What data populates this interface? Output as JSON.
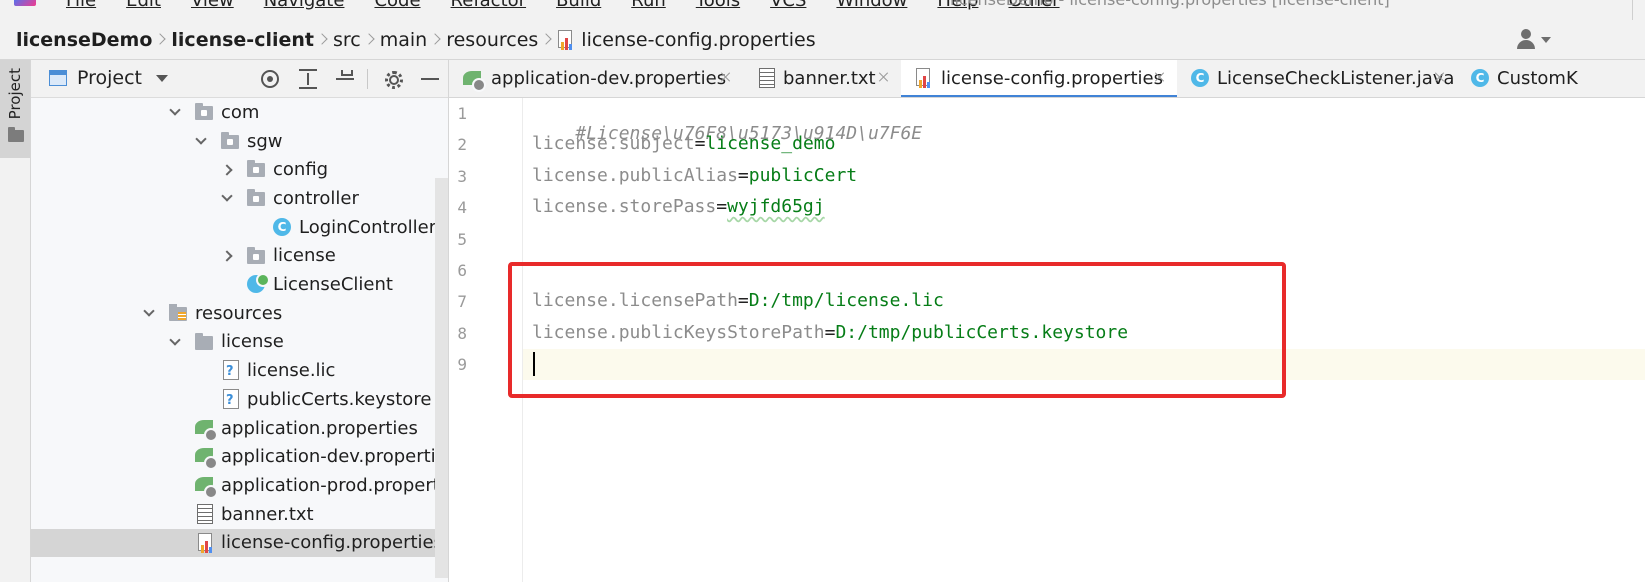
{
  "menu": {
    "items": [
      "File",
      "Edit",
      "View",
      "Navigate",
      "Code",
      "Refactor",
      "Build",
      "Run",
      "Tools",
      "VCS",
      "Window",
      "Help",
      "Other"
    ],
    "window_title": "licenseDemo - license-config.properties [license-client]"
  },
  "breadcrumb": {
    "items": [
      "licenseDemo",
      "license-client",
      "src",
      "main",
      "resources"
    ],
    "current_file": "license-config.properties"
  },
  "toolstrip": {
    "project_label": "Project"
  },
  "project_panel": {
    "title": "Project",
    "tree": [
      {
        "label": "com",
        "expanded": true,
        "icon": "folder-icon"
      },
      {
        "label": "sgw",
        "expanded": true,
        "icon": "folder-icon"
      },
      {
        "label": "config",
        "expanded": false,
        "icon": "folder-icon"
      },
      {
        "label": "controller",
        "expanded": true,
        "icon": "folder-icon"
      },
      {
        "label": "LoginController",
        "icon": "class-icon"
      },
      {
        "label": "license",
        "expanded": false,
        "icon": "folder-icon"
      },
      {
        "label": "LicenseClient",
        "icon": "spring-boot-class-icon"
      },
      {
        "label": "resources",
        "expanded": true,
        "icon": "resources-folder-icon"
      },
      {
        "label": "license",
        "expanded": true,
        "icon": "folder-icon"
      },
      {
        "label": "license.lic",
        "icon": "unknown-file-icon"
      },
      {
        "label": "publicCerts.keystore",
        "icon": "unknown-file-icon"
      },
      {
        "label": "application.properties",
        "icon": "spring-properties-icon"
      },
      {
        "label": "application-dev.properties",
        "icon": "spring-properties-icon"
      },
      {
        "label": "application-prod.properties",
        "icon": "spring-properties-icon"
      },
      {
        "label": "banner.txt",
        "icon": "text-file-icon"
      },
      {
        "label": "license-config.properties",
        "icon": "properties-file-icon",
        "selected": true
      }
    ]
  },
  "tabs": [
    {
      "label": "application-dev.properties",
      "icon": "spring-properties-icon"
    },
    {
      "label": "banner.txt",
      "icon": "text-file-icon"
    },
    {
      "label": "license-config.properties",
      "icon": "properties-file-icon",
      "active": true
    },
    {
      "label": "LicenseCheckListener.java",
      "icon": "class-icon"
    },
    {
      "label": "CustomK",
      "icon": "class-icon"
    }
  ],
  "editor": {
    "line_numbers": [
      "1",
      "2",
      "3",
      "4",
      "5",
      "6",
      "7",
      "8",
      "9"
    ],
    "current_line": 9,
    "lines": {
      "l1_comment": "#License\\u76F8\\u5173\\u914D\\u7F6E",
      "l2_key": "license.subject",
      "l2_val": "license_demo",
      "l3_key": "license.publicAlias",
      "l3_val": "publicCert",
      "l4_key": "license.storePass",
      "l4_val": "wyjfd65gj",
      "l7_key": "license.licensePath",
      "l7_val": "D:/tmp/license.lic",
      "l8_key": "license.publicKeysStorePath",
      "l8_val": "D:/tmp/publicCerts.keystore",
      "eq": "="
    }
  },
  "colors": {
    "accent": "#4083d6",
    "highlight_box": "#e82a2a",
    "value_green": "#067d17",
    "key_gray": "#8c8c8c"
  }
}
